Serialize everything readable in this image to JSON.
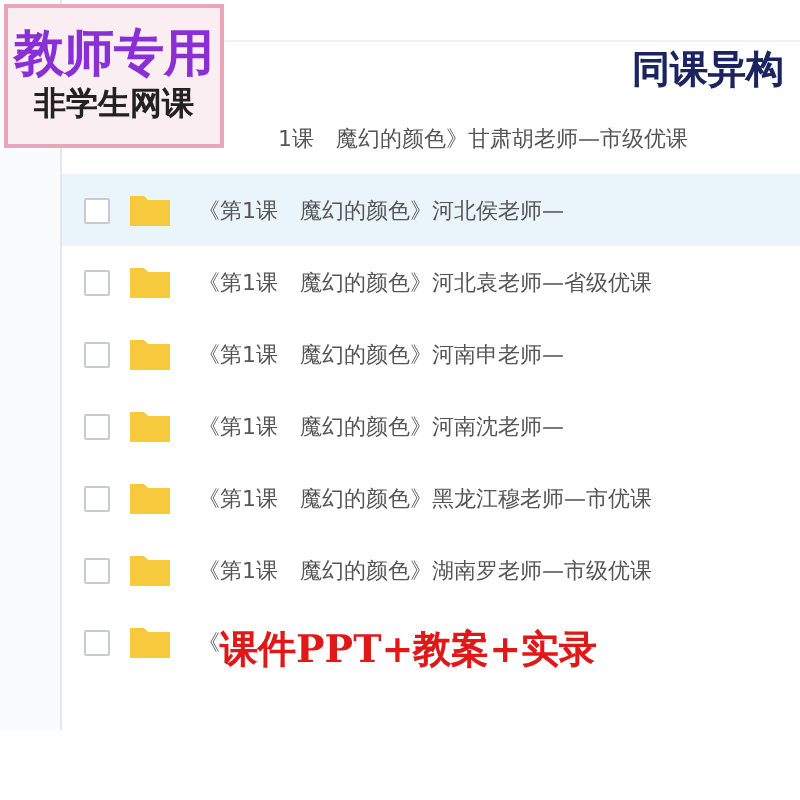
{
  "badge": {
    "title": "教师专用",
    "subtitle": "非学生网课"
  },
  "heading": "同课异构",
  "files": [
    {
      "kind": "under-badge",
      "name": "1课　魔幻的颜色》甘肃胡老师—市级优课",
      "selected": false
    },
    {
      "kind": "plain",
      "name": "《第1课　魔幻的颜色》河北侯老师—",
      "selected": true
    },
    {
      "kind": "plain",
      "name": "《第1课　魔幻的颜色》河北袁老师—省级优课",
      "selected": false
    },
    {
      "kind": "plain",
      "name": "《第1课　魔幻的颜色》河南申老师—",
      "selected": false
    },
    {
      "kind": "plain",
      "name": "《第1课　魔幻的颜色》河南沈老师—",
      "selected": false
    },
    {
      "kind": "plain",
      "name": "《第1课　魔幻的颜色》黑龙江穆老师—市优课",
      "selected": false
    },
    {
      "kind": "plain",
      "name": "《第1课　魔幻的颜色》湖南罗老师—市级优课",
      "selected": false
    },
    {
      "kind": "under-caption",
      "name": "《",
      "selected": false
    }
  ],
  "caption": "课件PPT+教案+实录"
}
